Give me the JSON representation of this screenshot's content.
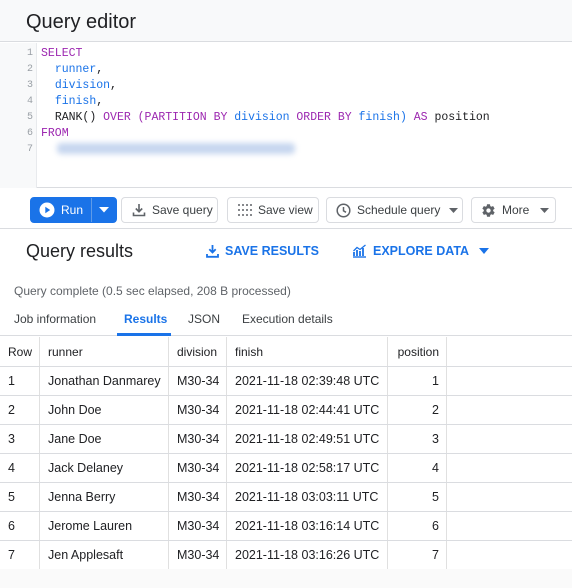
{
  "editor": {
    "title": "Query editor",
    "line_numbers": [
      "1",
      "2",
      "3",
      "4",
      "5",
      "6",
      "7"
    ],
    "code": {
      "select": "SELECT",
      "runner": "runner",
      "division": "division",
      "finish": "finish",
      "rank": "RANK()",
      "over": "OVER",
      "partition_by": "(PARTITION BY",
      "division2": "division",
      "order_by": "ORDER BY",
      "finish2": "finish)",
      "as": "AS",
      "position": "position",
      "from": "FROM",
      "comma": ","
    }
  },
  "toolbar": {
    "run_label": "Run",
    "save_query_label": "Save query",
    "save_view_label": "Save view",
    "schedule_query_label": "Schedule query",
    "more_label": "More"
  },
  "results": {
    "title": "Query results",
    "save_results_label": "SAVE RESULTS",
    "explore_data_label": "EXPLORE DATA",
    "status": "Query complete (0.5 sec elapsed, 208 B processed)",
    "tabs": [
      "Job information",
      "Results",
      "JSON",
      "Execution details"
    ],
    "active_tab": "Results",
    "columns": [
      "Row",
      "runner",
      "division",
      "finish",
      "position"
    ],
    "rows": [
      [
        "1",
        "Jonathan Danmarey",
        "M30-34",
        "2021-11-18 02:39:48 UTC",
        "1"
      ],
      [
        "2",
        "John Doe",
        "M30-34",
        "2021-11-18 02:44:41 UTC",
        "2"
      ],
      [
        "3",
        "Jane Doe",
        "M30-34",
        "2021-11-18 02:49:51 UTC",
        "3"
      ],
      [
        "4",
        "Jack Delaney",
        "M30-34",
        "2021-11-18 02:58:17 UTC",
        "4"
      ],
      [
        "5",
        "Jenna Berry",
        "M30-34",
        "2021-11-18 03:03:11 UTC",
        "5"
      ],
      [
        "6",
        "Jerome Lauren",
        "M30-34",
        "2021-11-18 03:16:14 UTC",
        "6"
      ],
      [
        "7",
        "Jen Applesaft",
        "M30-34",
        "2021-11-18 03:16:26 UTC",
        "7"
      ]
    ]
  },
  "colors": {
    "accent": "#1a73e8",
    "keyword": "#9c27b0",
    "identifier": "#1a73e8"
  }
}
